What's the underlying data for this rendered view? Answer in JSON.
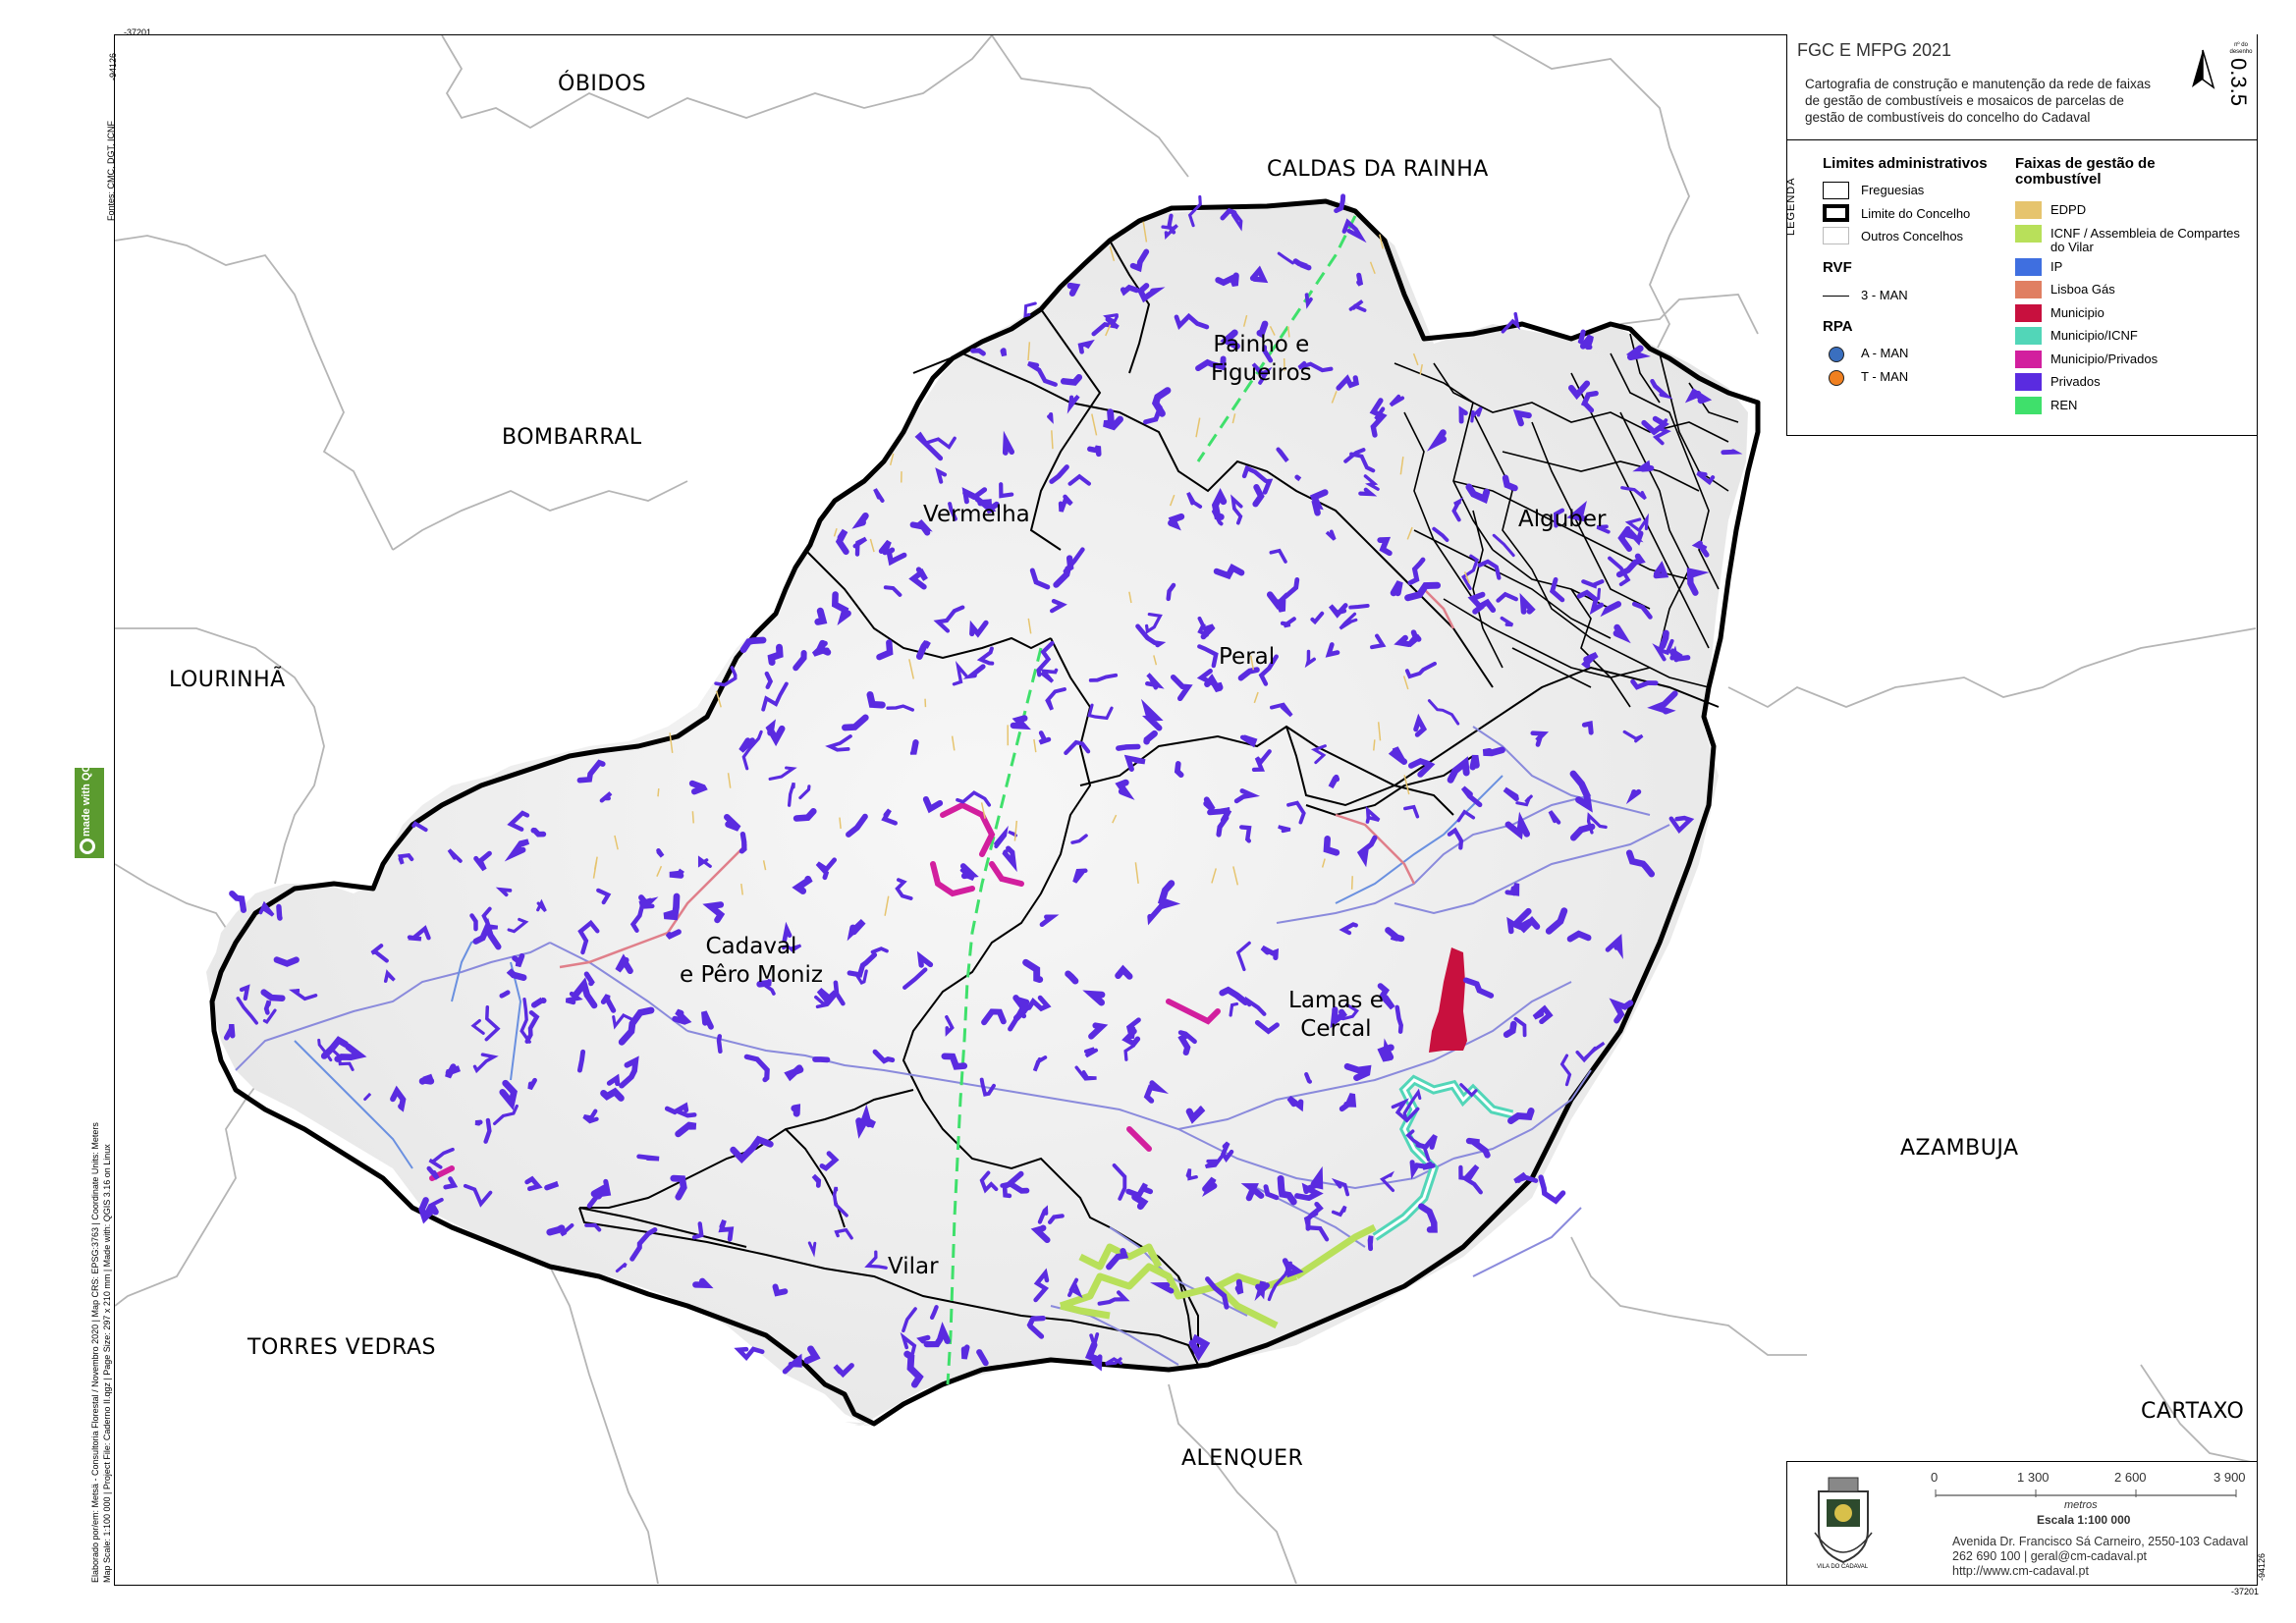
{
  "map": {
    "title": "FGC E MFPG 2021",
    "description": "Cartografia de construção e manutenção da rede de faixas de gestão de combustíveis e mosaicos de parcelas de gestão de combustíveis do concelho do Cadaval",
    "sheet_label": "nº do desenho",
    "sheet_number": "0.3.5",
    "coords": {
      "top_left": "-37201",
      "left_vertical": "-94126",
      "bottom_right_vertical": "-94126",
      "bottom_right": "-37201"
    },
    "sources": "Fontes: CMC, DGT, ICNF",
    "credits_line1": "Elaborado por/em: Metsä - Consultoria Florestal / Novembro 2020 | Map CRS: EPSG:3763 | Coordinate Units: Meters",
    "credits_line2": "Map Scale: 1:100 000 | Project File: Caderno II.qgz | Page Size: 297 x 210 mm | Made with: QGIS 3.16 on Linux",
    "qgis_badge": "made with QGIS"
  },
  "neighbours": [
    {
      "name": "ÓBIDOS"
    },
    {
      "name": "CALDAS DA RAINHA"
    },
    {
      "name": "BOMBARRAL"
    },
    {
      "name": "LOURINHÃ"
    },
    {
      "name": "TORRES VEDRAS"
    },
    {
      "name": "ALENQUER"
    },
    {
      "name": "AZAMBUJA"
    },
    {
      "name": "CARTAXO"
    }
  ],
  "parishes": [
    {
      "line1": "Painho e",
      "line2": "Figueiros"
    },
    {
      "line1": "Vermelha",
      "line2": ""
    },
    {
      "line1": "Alguber",
      "line2": ""
    },
    {
      "line1": "Peral",
      "line2": ""
    },
    {
      "line1": "Cadaval",
      "line2": "e Pêro Moniz"
    },
    {
      "line1": "Lamas e",
      "line2": "Cercal"
    },
    {
      "line1": "Vilar",
      "line2": ""
    }
  ],
  "legend": {
    "word": "LEGENDA",
    "admin_title": "Limites administrativos",
    "admin_items": [
      "Freguesias",
      "Limite do Concelho",
      "Outros Concelhos"
    ],
    "rvf_title": "RVF",
    "rvf_items": [
      "3 - MAN"
    ],
    "rpa_title": "RPA",
    "rpa_items": [
      {
        "label": "A - MAN",
        "color": "#3a6fbf"
      },
      {
        "label": "T - MAN",
        "color": "#f08020"
      }
    ],
    "fgc_title": "Faixas de gestão de combustível",
    "fgc_items": [
      {
        "label": "EDPD",
        "color": "#e6c46e"
      },
      {
        "label": "ICNF / Assembleia de Compartes do Vilar",
        "color": "#b8e05a"
      },
      {
        "label": "IP",
        "color": "#3f6fe0"
      },
      {
        "label": "Lisboa Gás",
        "color": "#e07f62"
      },
      {
        "label": "Municipio",
        "color": "#c8103e"
      },
      {
        "label": "Municipio/ICNF",
        "color": "#52d6b8"
      },
      {
        "label": "Municipio/Privados",
        "color": "#d21f9e"
      },
      {
        "label": "Privados",
        "color": "#5a2be0"
      },
      {
        "label": "REN",
        "color": "#3fe06b"
      }
    ]
  },
  "scalebar": {
    "ticks": [
      "0",
      "1 300",
      "2 600",
      "3 900"
    ],
    "unit": "metros",
    "scale": "Escala 1:100 000"
  },
  "contact": {
    "address": "Avenida Dr. Francisco Sá Carneiro, 2550-103 Cadaval",
    "phone_email": "262 690 100 | geral@cm-cadaval.pt",
    "web": "http://www.cm-cadaval.pt",
    "crest_text": "VILA DO CADAVAL"
  }
}
